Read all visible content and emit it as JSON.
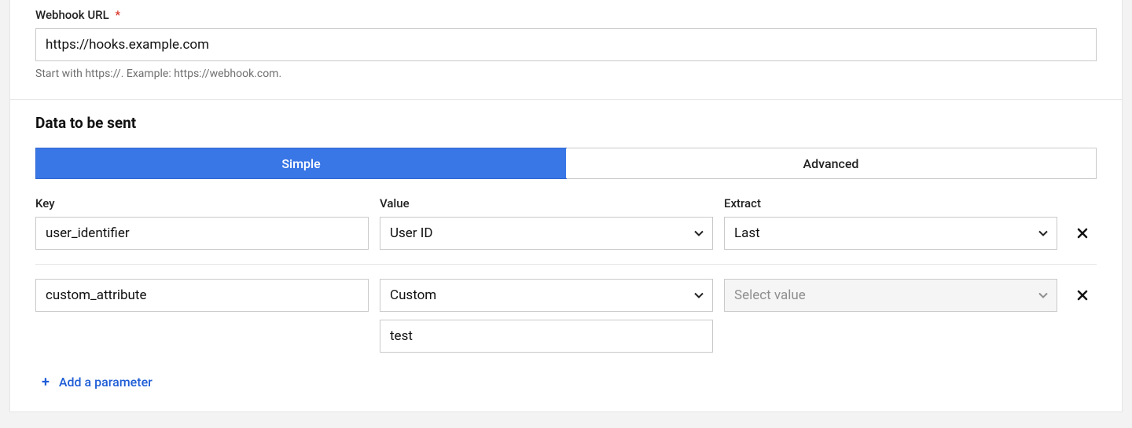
{
  "webhook": {
    "label": "Webhook URL",
    "required_mark": "*",
    "value": "https://hooks.example.com",
    "help": "Start with https://. Example: https://webhook.com."
  },
  "data_section": {
    "heading": "Data to be sent",
    "tabs": {
      "simple": "Simple",
      "advanced": "Advanced"
    },
    "headers": {
      "key": "Key",
      "value": "Value",
      "extract": "Extract"
    },
    "rows": [
      {
        "key": "user_identifier",
        "value": "User ID",
        "extract": "Last",
        "extract_disabled": false,
        "custom_value": null
      },
      {
        "key": "custom_attribute",
        "value": "Custom",
        "extract": "Select value",
        "extract_disabled": true,
        "custom_value": "test"
      }
    ],
    "add_parameter_label": "Add a parameter"
  }
}
